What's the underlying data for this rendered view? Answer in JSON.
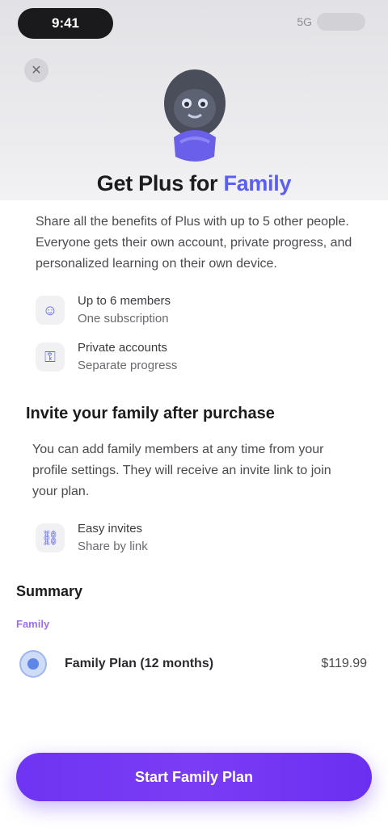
{
  "status_bar": {
    "time": "9:41",
    "right_label": "5G"
  },
  "header": {
    "close_icon": "close-icon",
    "title_main": "Get Plus for",
    "title_accent": "Family"
  },
  "intro": {
    "text": "Share all the benefits of Plus with up to 5 other people. Everyone gets their own account, private progress, and personalized learning on their own device."
  },
  "features": [
    {
      "icon": "people-icon",
      "title": "Up to 6 members",
      "subtitle": "One subscription"
    },
    {
      "icon": "lock-icon",
      "title": "Private accounts",
      "subtitle": "Separate progress"
    }
  ],
  "section": {
    "title": "Invite your family after purchase",
    "body": "You can add family members at any time from your profile settings. They will receive an invite link to join your plan.",
    "feature": {
      "icon": "link-icon",
      "title": "Easy invites",
      "subtitle": "Share by link"
    }
  },
  "summary": {
    "label": "Summary",
    "plan_tag": "Family",
    "option_label": "Family Plan (12 months)",
    "option_price": "$119.99"
  },
  "cta": {
    "label": "Start Family Plan"
  },
  "colors": {
    "accent": "#5b5ff0",
    "cta": "#6d35f2",
    "tag": "#9b6ff0"
  }
}
